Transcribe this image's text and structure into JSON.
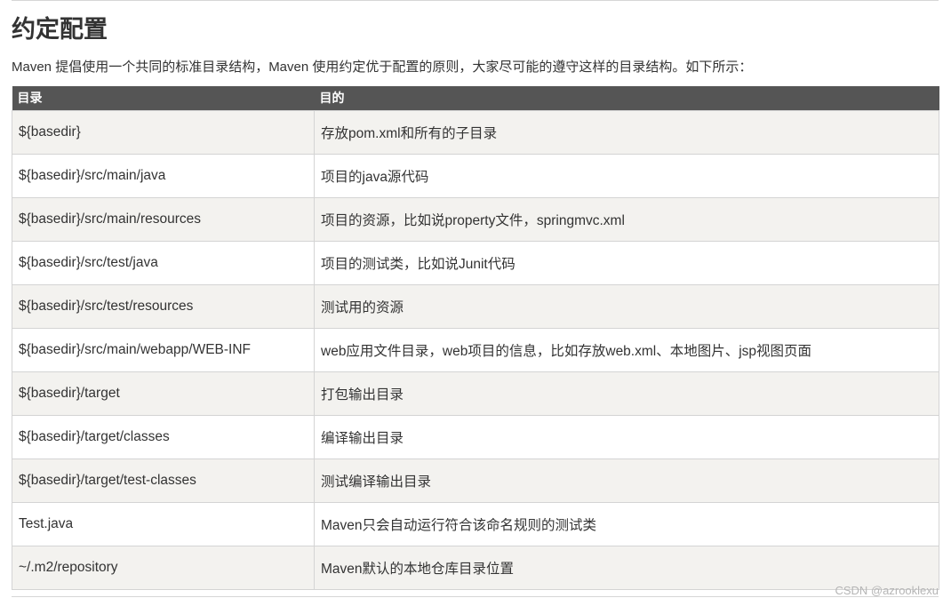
{
  "heading": "约定配置",
  "intro": "Maven 提倡使用一个共同的标准目录结构，Maven 使用约定优于配置的原则，大家尽可能的遵守这样的目录结构。如下所示：",
  "table": {
    "headers": [
      "目录",
      "目的"
    ],
    "rows": [
      [
        "${basedir}",
        "存放pom.xml和所有的子目录"
      ],
      [
        "${basedir}/src/main/java",
        "项目的java源代码"
      ],
      [
        "${basedir}/src/main/resources",
        "项目的资源，比如说property文件，springmvc.xml"
      ],
      [
        "${basedir}/src/test/java",
        "项目的测试类，比如说Junit代码"
      ],
      [
        "${basedir}/src/test/resources",
        "测试用的资源"
      ],
      [
        "${basedir}/src/main/webapp/WEB-INF",
        "web应用文件目录，web项目的信息，比如存放web.xml、本地图片、jsp视图页面"
      ],
      [
        "${basedir}/target",
        "打包输出目录"
      ],
      [
        "${basedir}/target/classes",
        "编译输出目录"
      ],
      [
        "${basedir}/target/test-classes",
        "测试编译输出目录"
      ],
      [
        "Test.java",
        "Maven只会自动运行符合该命名规则的测试类"
      ],
      [
        "~/.m2/repository",
        "Maven默认的本地仓库目录位置"
      ]
    ]
  },
  "watermark": "CSDN @azrooklexu"
}
